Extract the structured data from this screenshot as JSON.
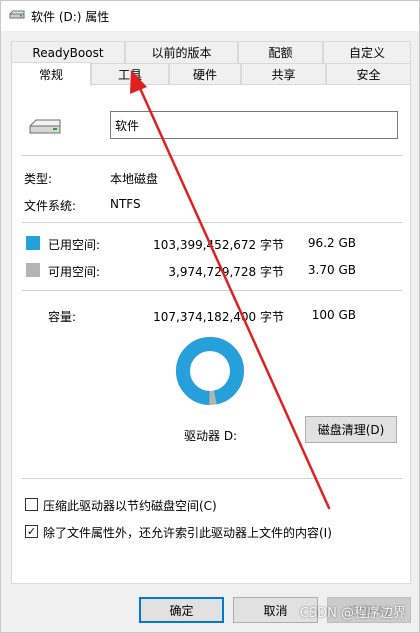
{
  "window": {
    "title": "软件 (D:) 属性"
  },
  "tabs": {
    "row1": [
      {
        "label": "ReadyBoost"
      },
      {
        "label": "以前的版本"
      },
      {
        "label": "配额"
      },
      {
        "label": "自定义"
      }
    ],
    "row2": [
      {
        "label": "常规",
        "active": true
      },
      {
        "label": "工具"
      },
      {
        "label": "硬件"
      },
      {
        "label": "共享"
      },
      {
        "label": "安全"
      }
    ]
  },
  "general": {
    "name_value": "软件",
    "type_label": "类型:",
    "type_value": "本地磁盘",
    "fs_label": "文件系统:",
    "fs_value": "NTFS",
    "used_label": "已用空间:",
    "used_bytes": "103,399,452,672 字节",
    "used_size": "96.2 GB",
    "free_label": "可用空间:",
    "free_bytes": "3,974,729,728 字节",
    "free_size": "3.70 GB",
    "capacity_label": "容量:",
    "capacity_bytes": "107,374,182,400 字节",
    "capacity_size": "100 GB",
    "drive_label": "驱动器 D:",
    "cleanup_button": "磁盘清理(D)",
    "compress_label": "压缩此驱动器以节约磁盘空间(C)",
    "compress_checked": false,
    "index_label": "除了文件属性外，还允许索引此驱动器上文件的内容(I)",
    "index_checked": true,
    "used_fraction": 0.963,
    "colors": {
      "used": "#26a0da",
      "free": "#b4b4b4"
    }
  },
  "footer": {
    "ok_button": "确定",
    "cancel_button": "取消",
    "apply_button": "应用(A)"
  },
  "watermark": "CSDN @程序边界"
}
